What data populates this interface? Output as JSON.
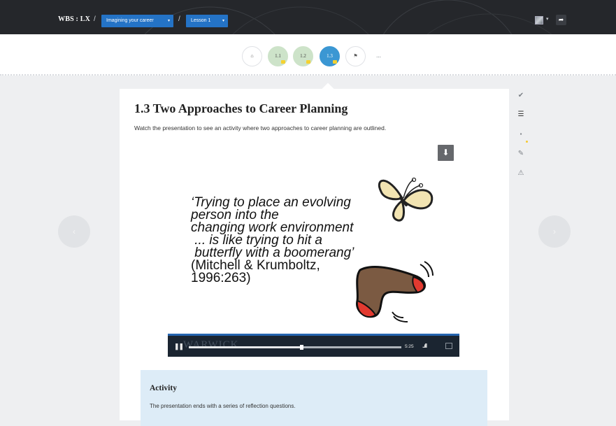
{
  "header": {
    "brand": "WBS : LX",
    "separator": "/",
    "module_label": "Imagining your career",
    "lesson_label": "Lesson 1",
    "caret": "▾",
    "share_icon": "➦"
  },
  "steps": [
    {
      "label": "",
      "icon": "home-icon",
      "glyph": "⌂"
    },
    {
      "label": "1.1"
    },
    {
      "label": "1.2"
    },
    {
      "label": "1.3"
    },
    {
      "label": "",
      "icon": "flag-icon",
      "glyph": "⚑"
    },
    {
      "label": "..."
    }
  ],
  "nav": {
    "prev_glyph": "‹",
    "next_glyph": "›"
  },
  "content": {
    "title": "1.3 Two Approaches to Career Planning",
    "subtitle": "Watch the presentation to see an activity where two approaches to career planning are outlined."
  },
  "video": {
    "download_glyph": "⬇",
    "slide_quote_line1": "‘Trying to place an evolving",
    "slide_quote_line2": "person into the",
    "slide_quote_line3": "changing work environment",
    "slide_quote_line4": " ... is like trying to hit a",
    "slide_quote_line5": " butterfly with a boomerang’",
    "slide_citation_line1": "(Mitchell & Krumboltz,",
    "slide_citation_line2": "1996:263)",
    "player_brand": "WARWICK",
    "time": "5:25",
    "progress_fraction": 0.53,
    "pause_glyph": "❚❚",
    "volume_glyph": "..ıll"
  },
  "activity": {
    "heading": "Activity",
    "text": "The presentation ends with a series of reflection questions."
  },
  "sidebar": {
    "check_glyph": "✔",
    "text_glyph": "☰",
    "comment_glyph": "▪",
    "pencil_glyph": "✎",
    "warning_glyph": "⚠"
  },
  "colors": {
    "topbar": "#25272b",
    "accent_blue": "#2473c6",
    "active_step": "#3b97d3",
    "done_step": "#cde3c9",
    "activity_bg": "#ddecf7"
  }
}
